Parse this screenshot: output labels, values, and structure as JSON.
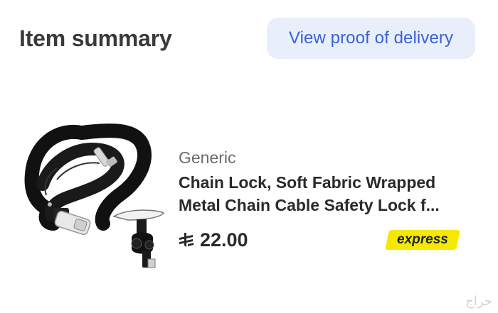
{
  "header": {
    "title": "Item summary",
    "proof_button_label": "View proof of delivery"
  },
  "item": {
    "brand": "Generic",
    "title_line1": "Chain Lock, Soft Fabric Wrapped",
    "title_line2": "Metal Chain Cable Safety Lock f...",
    "price": "22.00",
    "currency_icon": "riyal-currency-icon",
    "badge_label": "express",
    "image_icon": "chain-lock-product-image"
  },
  "watermark": "حراج",
  "colors": {
    "accent_text": "#3a63d4",
    "button_bg": "#e9eefb",
    "badge_bg": "#f6e900"
  }
}
